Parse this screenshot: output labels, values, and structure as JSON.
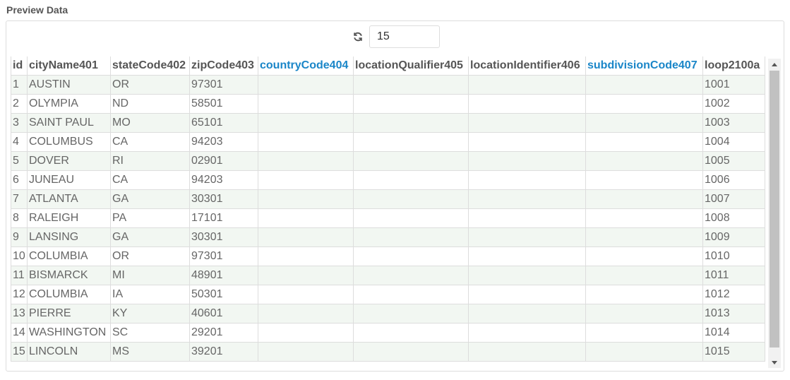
{
  "title": "Preview Data",
  "toolbar": {
    "refresh_icon": "refresh-icon",
    "count_value": "15"
  },
  "colors": {
    "header_blue": "#1a86c8",
    "row_stripe": "#f2f7f2",
    "border": "#dddddd"
  },
  "table": {
    "columns": [
      {
        "label": "id",
        "highlight": false
      },
      {
        "label": "cityName401",
        "highlight": false
      },
      {
        "label": "stateCode402",
        "highlight": false
      },
      {
        "label": "zipCode403",
        "highlight": false
      },
      {
        "label": "countryCode404",
        "highlight": true
      },
      {
        "label": "locationQualifier405",
        "highlight": false
      },
      {
        "label": "locationIdentifier406",
        "highlight": false
      },
      {
        "label": "subdivisionCode407",
        "highlight": true
      },
      {
        "label": "loop2100a",
        "highlight": false
      }
    ],
    "rows": [
      [
        "1",
        "AUSTIN",
        "OR",
        "97301",
        "",
        "",
        "",
        "",
        "1001"
      ],
      [
        "2",
        "OLYMPIA",
        "ND",
        "58501",
        "",
        "",
        "",
        "",
        "1002"
      ],
      [
        "3",
        "SAINT PAUL",
        "MO",
        "65101",
        "",
        "",
        "",
        "",
        "1003"
      ],
      [
        "4",
        "COLUMBUS",
        "CA",
        "94203",
        "",
        "",
        "",
        "",
        "1004"
      ],
      [
        "5",
        "DOVER",
        "RI",
        "02901",
        "",
        "",
        "",
        "",
        "1005"
      ],
      [
        "6",
        "JUNEAU",
        "CA",
        "94203",
        "",
        "",
        "",
        "",
        "1006"
      ],
      [
        "7",
        "ATLANTA",
        "GA",
        "30301",
        "",
        "",
        "",
        "",
        "1007"
      ],
      [
        "8",
        "RALEIGH",
        "PA",
        "17101",
        "",
        "",
        "",
        "",
        "1008"
      ],
      [
        "9",
        "LANSING",
        "GA",
        "30301",
        "",
        "",
        "",
        "",
        "1009"
      ],
      [
        "10",
        "COLUMBIA",
        "OR",
        "97301",
        "",
        "",
        "",
        "",
        "1010"
      ],
      [
        "11",
        "BISMARCK",
        "MI",
        "48901",
        "",
        "",
        "",
        "",
        "1011"
      ],
      [
        "12",
        "COLUMBIA",
        "IA",
        "50301",
        "",
        "",
        "",
        "",
        "1012"
      ],
      [
        "13",
        "PIERRE",
        "KY",
        "40601",
        "",
        "",
        "",
        "",
        "1013"
      ],
      [
        "14",
        "WASHINGTON",
        "SC",
        "29201",
        "",
        "",
        "",
        "",
        "1014"
      ],
      [
        "15",
        "LINCOLN",
        "MS",
        "39201",
        "",
        "",
        "",
        "",
        "1015"
      ]
    ]
  }
}
